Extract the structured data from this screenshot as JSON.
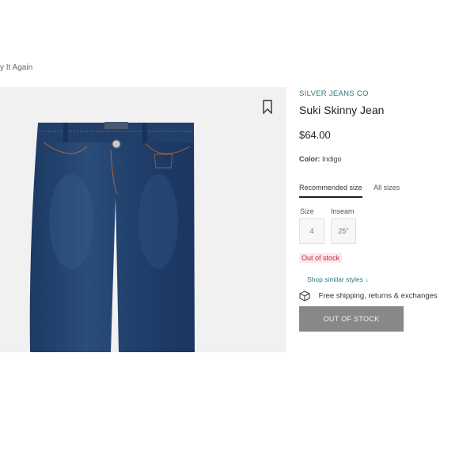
{
  "breadcrumb": "y It Again",
  "product": {
    "brand": "SILVER JEANS CO",
    "name": "Suki Skinny Jean",
    "price": "$64.00",
    "color_label": "Color:",
    "color_value": "Indigo"
  },
  "size_tabs": [
    "Recommended size",
    "All sizes"
  ],
  "size_label": "Size",
  "inseam_label": "Inseam",
  "size_value": "4",
  "inseam_value": "25\"",
  "stock_badge": "Out of stock",
  "shop_similar": "Shop similar styles ↓",
  "shipping_text": "Free shipping, returns & exchanges",
  "button_label": "OUT OF STOCK",
  "colors": {
    "brand": "#2a7a7a",
    "denim": "#1f3c66",
    "oos_red": "#c22636",
    "button": "#888888"
  },
  "icons": [
    "bookmark-icon",
    "box-icon"
  ]
}
